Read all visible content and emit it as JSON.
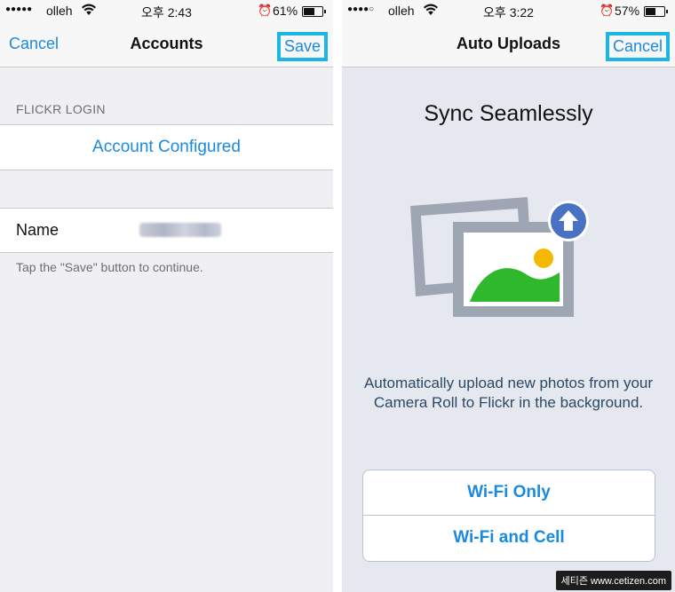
{
  "left_screen": {
    "status": {
      "signal": "●●●●●",
      "carrier": "olleh",
      "wifi_icon": "wifi-icon",
      "time": "오후 2:43",
      "alarm_icon": "alarm-icon",
      "battery": "61%",
      "battery_level": 0.61
    },
    "nav": {
      "left": "Cancel",
      "title": "Accounts",
      "right": "Save"
    },
    "section_header": "FLICKR LOGIN",
    "account_status": "Account Configured",
    "name_label": "Name",
    "footer": "Tap the \"Save\" button to continue."
  },
  "right_screen": {
    "status": {
      "signal": "●●●●○",
      "carrier": "olleh",
      "wifi_icon": "wifi-icon",
      "time": "오후 3:22",
      "alarm_icon": "alarm-icon",
      "battery": "57%",
      "battery_level": 0.57
    },
    "nav": {
      "title": "Auto Uploads",
      "right": "Cancel"
    },
    "heading": "Sync Seamlessly",
    "description": "Automatically upload new photos from your Camera Roll to Flickr in the background.",
    "options": [
      "Wi-Fi Only",
      "Wi-Fi and Cell"
    ]
  },
  "watermark": "세티즌 www.cetizen.com",
  "colors": {
    "accent": "#1a8ae0",
    "highlight_box": "#1ab6e4",
    "upload_badge": "#4a72c4",
    "photo_green": "#2fb82c",
    "photo_sun": "#f5b800"
  }
}
